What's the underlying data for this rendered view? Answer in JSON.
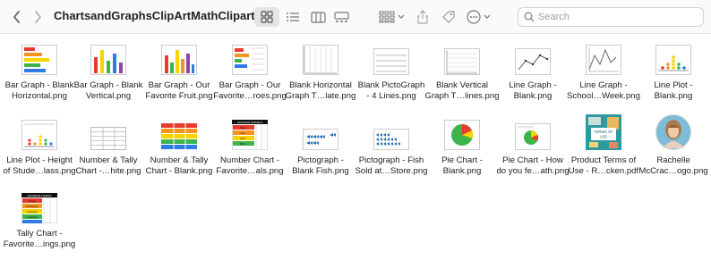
{
  "window": {
    "title": "ChartsandGraphsClipArtMathClipart-1"
  },
  "toolbar": {
    "search_placeholder": "Search"
  },
  "files": [
    {
      "line1": "Bar Graph - Blank",
      "line2": "Horizontal.png"
    },
    {
      "line1": "Bar Graph - Blank",
      "line2": "Vertical.png"
    },
    {
      "line1": "Bar Graph - Our",
      "line2": "Favorite Fruit.png"
    },
    {
      "line1": "Bar Graph - Our",
      "line2": "Favorite…roes.png"
    },
    {
      "line1": "Blank Horizontal",
      "line2": "Graph T…late.png"
    },
    {
      "line1": "Blank PictoGraph",
      "line2": "- 4 Lines.png"
    },
    {
      "line1": "Blank Vertical",
      "line2": "Graph T…lines.png"
    },
    {
      "line1": "Line Graph -",
      "line2": "Blank.png"
    },
    {
      "line1": "Line Graph -",
      "line2": "School…Week.png"
    },
    {
      "line1": "Line Plot -",
      "line2": "Blank.png"
    },
    {
      "line1": "Line Plot - Height",
      "line2": "of Stude…lass.png"
    },
    {
      "line1": "Number & Tally",
      "line2": "Chart -…hite.png"
    },
    {
      "line1": "Number & Tally",
      "line2": "Chart - Blank.png"
    },
    {
      "line1": "Number Chart -",
      "line2": "Favorite…als.png"
    },
    {
      "line1": "Pictograph -",
      "line2": "Blank Fish.png"
    },
    {
      "line1": "Pictograph - Fish",
      "line2": "Sold at…Store.png"
    },
    {
      "line1": "Pie Chart -",
      "line2": "Blank.png"
    },
    {
      "line1": "Pie Chart - How",
      "line2": "do you fe…ath.png"
    },
    {
      "line1": "Product Terms of",
      "line2": "Use - R…cken.pdf"
    },
    {
      "line1": "Rachelle",
      "line2": "McCrac…ogo.png"
    },
    {
      "line1": "Tally Chart -",
      "line2": "Favorite…ings.png"
    }
  ],
  "thumb_text": {
    "terms_line1": "TERMS OF",
    "terms_line2": "USE",
    "number_chart_header": "FAVORITE ANIMALS",
    "number_chart_rows": [
      "Dog",
      "Cat",
      "Fish",
      "Bird",
      "Horse"
    ],
    "tally_header": "FAVORITE THINGS",
    "tally_rows": [
      "Pizza",
      "Pineapple",
      "Pretzels",
      "Cookies",
      "Cheese"
    ]
  }
}
